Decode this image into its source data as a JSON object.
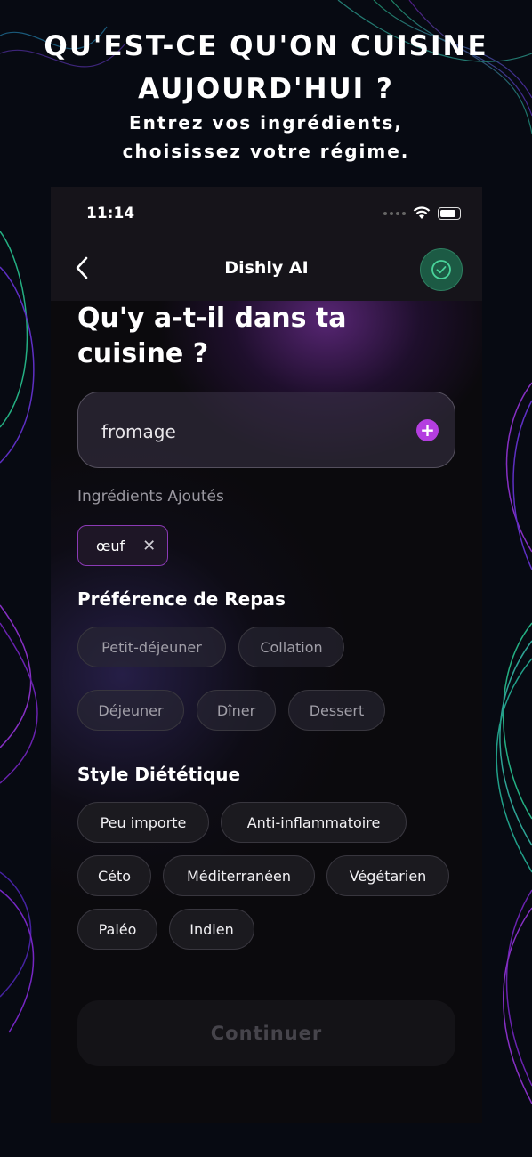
{
  "promo": {
    "headline_line1": "QU'EST-CE QU'ON CUISINE",
    "headline_line2": "AUJOURD'HUI ?",
    "sub_line1": "Entrez vos ingrédients,",
    "sub_line2": "choisissez votre régime."
  },
  "status_bar": {
    "time": "11:14"
  },
  "nav": {
    "title": "Dishly AI"
  },
  "page": {
    "title_line1": "Qu'y a-t-il dans ta",
    "title_line2": "cuisine ?"
  },
  "ingredient_input": {
    "value": "fromage"
  },
  "added": {
    "label": "Ingrédients Ajoutés",
    "items": [
      "œuf"
    ]
  },
  "meal": {
    "title": "Préférence de Repas",
    "options": [
      "Petit-déjeuner",
      "Collation",
      "Déjeuner",
      "Dîner",
      "Dessert"
    ]
  },
  "diet": {
    "title": "Style Diététique",
    "options": [
      "Peu importe",
      "Anti-inflammatoire",
      "Céto",
      "Méditerranéen",
      "Végétarien",
      "Paléo",
      "Indien"
    ]
  },
  "continue_label": "Continuer",
  "colors": {
    "accent_purple": "#b43ee0",
    "check_green": "#1c5a44",
    "background": "#0b0a0d"
  }
}
